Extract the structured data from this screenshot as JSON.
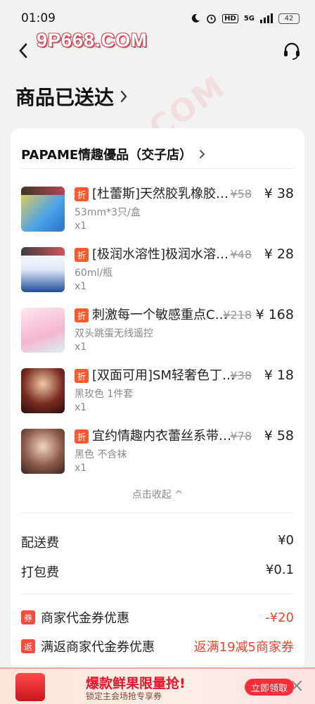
{
  "status_bar": {
    "time": "01:09",
    "hd": "HD",
    "network": "5G",
    "battery": "42"
  },
  "watermark": {
    "top": "9P668.COM",
    "diagonal": "9P668.COM"
  },
  "header": {
    "title": "商品已送达"
  },
  "shop": {
    "name": "PAPAME情趣優品（交子店）"
  },
  "discount_badge": "折",
  "products": [
    {
      "name": "[杜蕾斯]天然胶乳橡胶避孕套",
      "spec": "53mm*3只/盒",
      "qty": "x1",
      "orig_price": "¥58",
      "price": "¥ 38"
    },
    {
      "name": "[极润水溶性]极润水溶性润滑液",
      "spec": "60ml/瓶",
      "qty": "x1",
      "orig_price": "¥48",
      "price": "¥ 28"
    },
    {
      "name": "刺激每一个敏感重点C位跳蛋",
      "spec": "双头跳蛋无线遥控",
      "qty": "x1",
      "orig_price": "¥218",
      "price": "¥ 168"
    },
    {
      "name": "[双面可用]SM轻奢色丁布眼罩",
      "spec": "黑玫色 1件套",
      "qty": "x1",
      "orig_price": "¥38",
      "price": "¥ 18"
    },
    {
      "name": "宜约情趣内衣蕾丝系带挂脖连体",
      "spec": "黑色 不含袜",
      "qty": "x1",
      "orig_price": "¥78",
      "price": "¥ 58"
    }
  ],
  "collapse_label": "点击收起 ^",
  "fees": [
    {
      "label": "配送费",
      "value": "¥0"
    },
    {
      "label": "打包费",
      "value": "¥0.1"
    }
  ],
  "coupons": [
    {
      "icon": "券",
      "label": "商家代金券优惠",
      "value": "-¥20"
    },
    {
      "icon": "返",
      "label": "满返商家代金券优惠",
      "value": "返满19减5商家券"
    }
  ],
  "banner": {
    "title": "爆款鲜果限量抢!",
    "subtitle": "锁定主会场抢专享券",
    "button": "立即领取"
  },
  "colors": {
    "accent": "#ff5a2c",
    "price_red": "#e8452d",
    "banner_red": "#ff2d3a"
  }
}
